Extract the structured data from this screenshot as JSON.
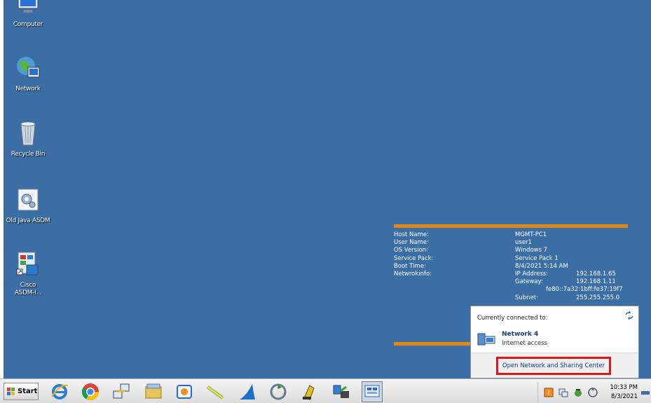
{
  "desktop": {
    "icons": [
      {
        "label": "Computer",
        "icon": "computer-icon"
      },
      {
        "label": "Network",
        "icon": "network-icon"
      },
      {
        "label": "Recycle Bin",
        "icon": "recycle-bin-icon"
      },
      {
        "label": "Old Java ASDM",
        "icon": "asdm-settings-icon"
      },
      {
        "label": "Cisco ASDM-I...",
        "icon": "cisco-asdm-shortcut-icon"
      }
    ]
  },
  "bginfo": {
    "rows": [
      {
        "key": "Host Name:",
        "value": "MGMT-PC1"
      },
      {
        "key": "User Name:",
        "value": "user1"
      },
      {
        "key": "OS Version:",
        "value": "Windows 7"
      },
      {
        "key": "Service Pack:",
        "value": "Service Pack 1"
      },
      {
        "key": "Boot Time:",
        "value": "8/4/2021 5:14 AM"
      },
      {
        "key": "Netwrokinfo:",
        "ip_label": "IP Address:",
        "ip_value": "192.168.1.65"
      }
    ],
    "gateway_label": "Gateway:",
    "gateway_value": "192.168.1.11",
    "ipv6": "fe80::7a32:1bff:fe37:19f7",
    "subnet_label": "Subnet:",
    "subnet_value": "255.255.255.0",
    "accent_color": "#e58811"
  },
  "network_popup": {
    "connected_to": "Currently connected to:",
    "network_name": "Network 4",
    "network_status": "Internet access",
    "open_link": "Open Network and Sharing Center"
  },
  "taskbar": {
    "start_label": "Start",
    "pinned": [
      "internet-explorer-icon",
      "chrome-icon",
      "network-tool-icon",
      "file-explorer-icon",
      "media-player-icon",
      "cable-tool-icon",
      "wireshark-icon",
      "refresh-app-icon",
      "putty-icon",
      "network-drive-icon",
      "active-app-icon"
    ],
    "tray_icons": [
      "security-alert-icon",
      "network-tray-icon",
      "flag-icon",
      "volume-icon"
    ],
    "time": "10:33 PM",
    "date": "8/3/2021"
  }
}
